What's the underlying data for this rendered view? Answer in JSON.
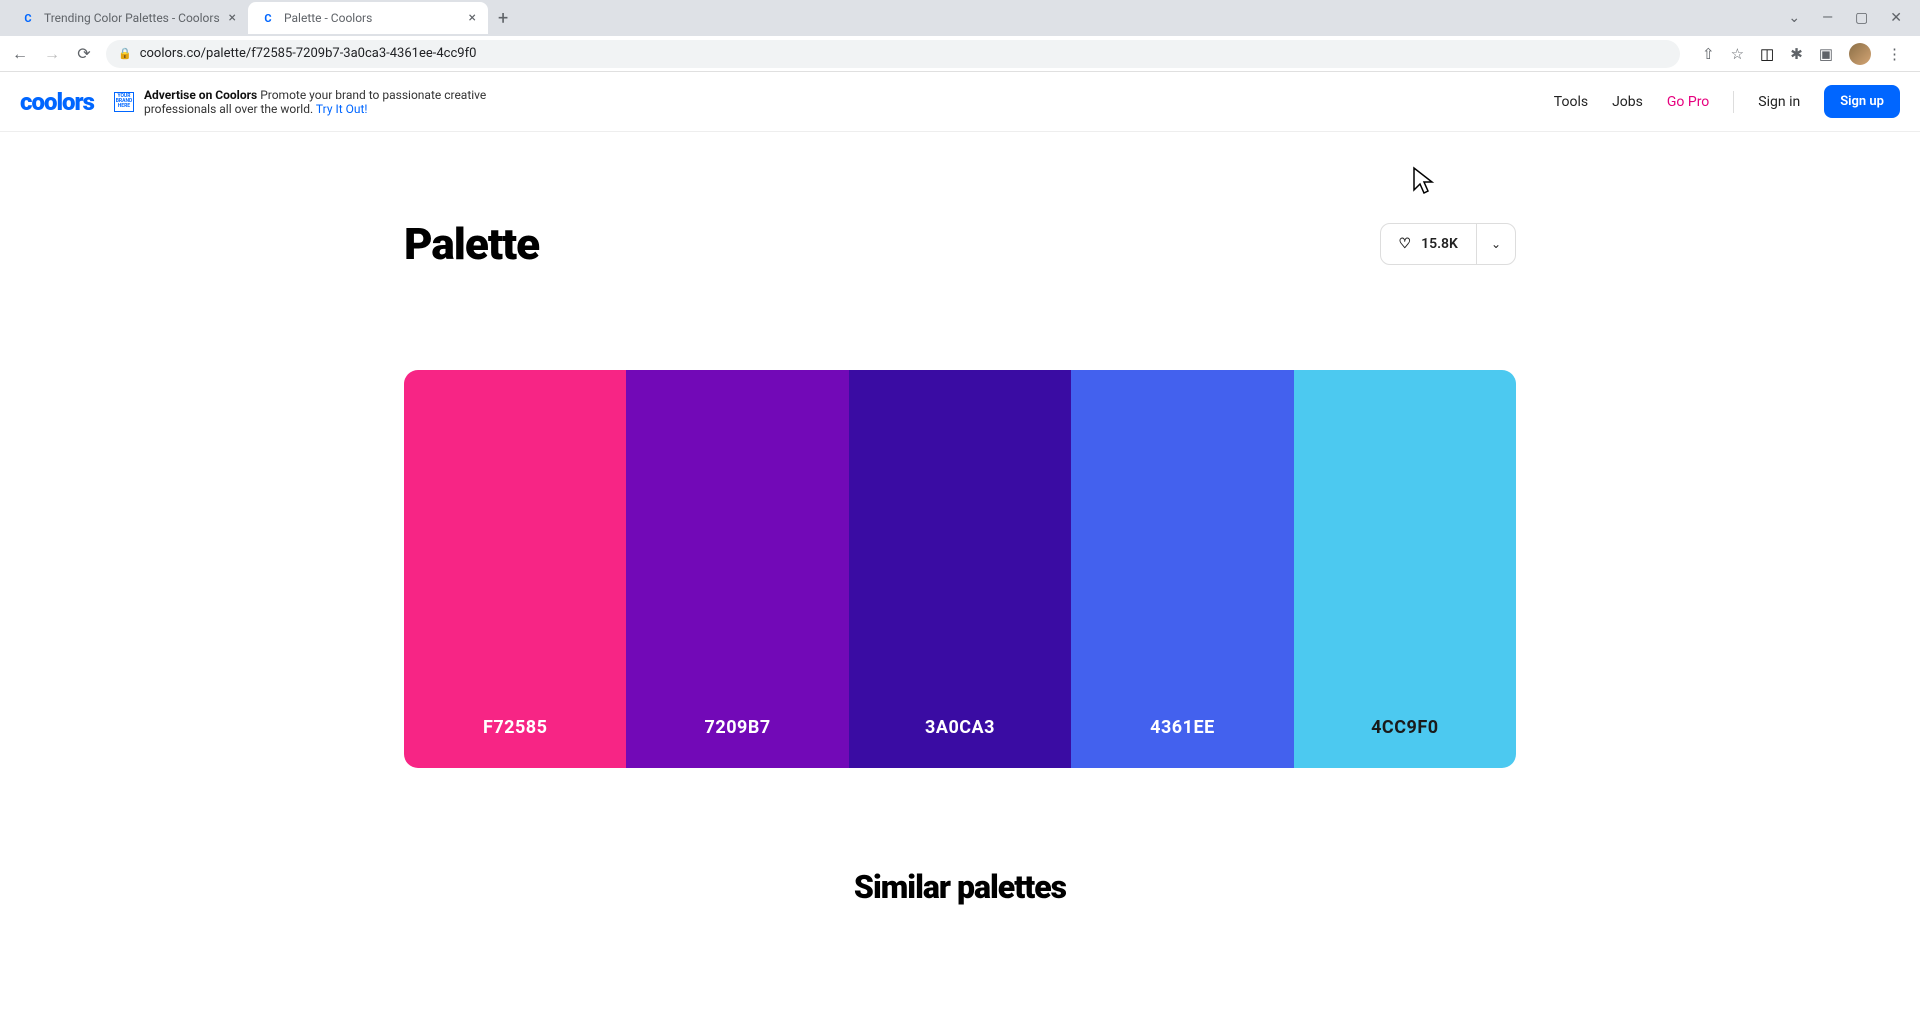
{
  "browser": {
    "tabs": [
      {
        "title": "Trending Color Palettes - Coolors",
        "active": false
      },
      {
        "title": "Palette - Coolors",
        "active": true
      }
    ],
    "url": "coolors.co/palette/f72585-7209b7-3a0ca3-4361ee-4cc9f0"
  },
  "header": {
    "logo": "coolors",
    "advert": {
      "brand_line1": "YOUR",
      "brand_line2": "BRAND",
      "brand_line3": "HERE",
      "title": "Advertise on Coolors",
      "body": "Promote your brand to passionate creative professionals all over the world.",
      "cta": "Try It Out!"
    },
    "nav": {
      "tools": "Tools",
      "jobs": "Jobs",
      "gopro": "Go Pro",
      "signin": "Sign in",
      "signup": "Sign up"
    }
  },
  "page": {
    "title": "Palette",
    "likes": "15.8K"
  },
  "palette": [
    {
      "hex": "F72585",
      "bg": "#F72585",
      "text_class": "light"
    },
    {
      "hex": "7209B7",
      "bg": "#7209B7",
      "text_class": "light"
    },
    {
      "hex": "3A0CA3",
      "bg": "#3A0CA3",
      "text_class": "light"
    },
    {
      "hex": "4361EE",
      "bg": "#4361EE",
      "text_class": "light"
    },
    {
      "hex": "4CC9F0",
      "bg": "#4CC9F0",
      "text_class": "dark"
    }
  ],
  "similar_title": "Similar palettes"
}
